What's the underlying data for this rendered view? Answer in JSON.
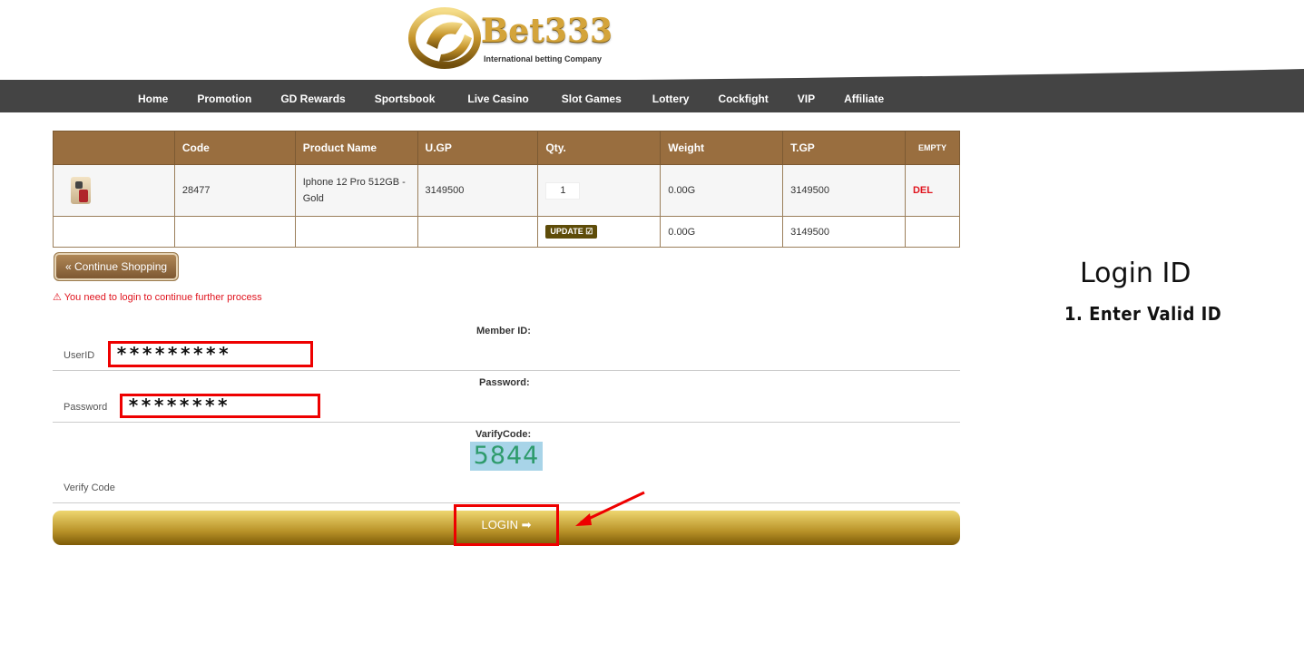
{
  "logo": {
    "brand": "Bet333",
    "tagline": "International betting Company"
  },
  "nav": [
    "Home",
    "Promotion",
    "GD Rewards",
    "Sportsbook",
    "Live Casino",
    "Slot Games",
    "Lottery",
    "Cockfight",
    "VIP",
    "Affiliate"
  ],
  "cart": {
    "headers": [
      "",
      "Code",
      "Product Name",
      "U.GP",
      "Qty.",
      "Weight",
      "T.GP",
      "EMPTY"
    ],
    "item": {
      "code": "28477",
      "name": "Iphone 12 Pro 512GB - Gold",
      "ugp": "3149500",
      "qty": "1",
      "weight": "0.00G",
      "tgp": "3149500",
      "del": "DEL"
    },
    "totals": {
      "update": "UPDATE ☑",
      "weight": "0.00G",
      "tgp": "3149500"
    }
  },
  "continue_label": "« Continue Shopping",
  "warning": "⚠ You need to login to continue further process",
  "form": {
    "member_id_label": "Member ID:",
    "userid_label": "UserID",
    "userid_value": "*********",
    "password_label": "Password:",
    "password_field_label": "Password",
    "password_value": "********",
    "verify_label": "VarifyCode:",
    "captcha": "5844",
    "verify_field_label": "Verify Code",
    "login_label": "LOGIN ➡"
  },
  "side": {
    "title": "Login ID",
    "step": "1. Enter Valid ID"
  },
  "colors": {
    "header_brown": "#996e3f",
    "nav_bg": "#444444",
    "highlight": "#ee0000",
    "gold": "#b89228"
  }
}
